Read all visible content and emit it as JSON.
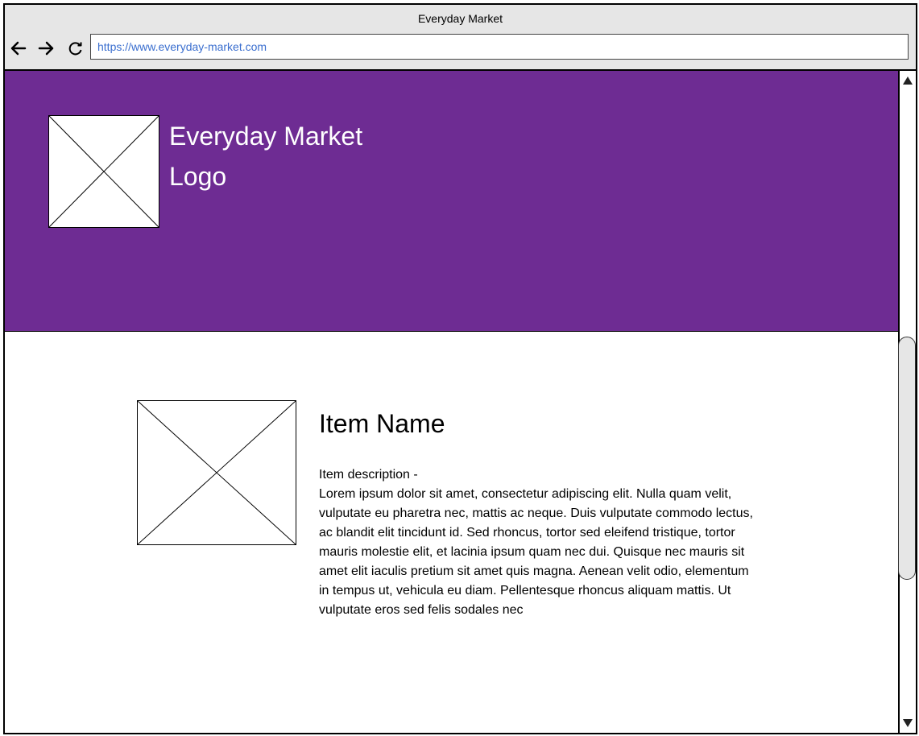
{
  "window": {
    "title": "Everyday Market"
  },
  "toolbar": {
    "url": "https://www.everyday-market.com",
    "icons": {
      "back": "back-arrow-icon",
      "forward": "forward-arrow-icon",
      "reload": "reload-icon"
    }
  },
  "header": {
    "background_color": "#6e2c93",
    "logo_text_line1": "Everyday Market",
    "logo_text_line2": "Logo"
  },
  "item": {
    "name": "Item Name",
    "description_label": "Item description -",
    "description": "Lorem ipsum dolor sit amet, consectetur adipiscing elit. Nulla quam velit, vulputate eu pharetra nec, mattis ac neque. Duis vulputate commodo lectus, ac blandit elit tincidunt id. Sed rhoncus, tortor sed eleifend tristique, tortor mauris molestie elit, et lacinia ipsum quam nec dui. Quisque nec mauris sit amet elit iaculis pretium sit amet quis magna. Aenean velit odio, elementum in tempus ut, vehicula eu diam. Pellentesque rhoncus aliquam mattis. Ut vulputate eros sed felis sodales nec"
  },
  "scrollbar": {
    "up_icon": "triangle-up-icon",
    "down_icon": "triangle-down-icon"
  }
}
